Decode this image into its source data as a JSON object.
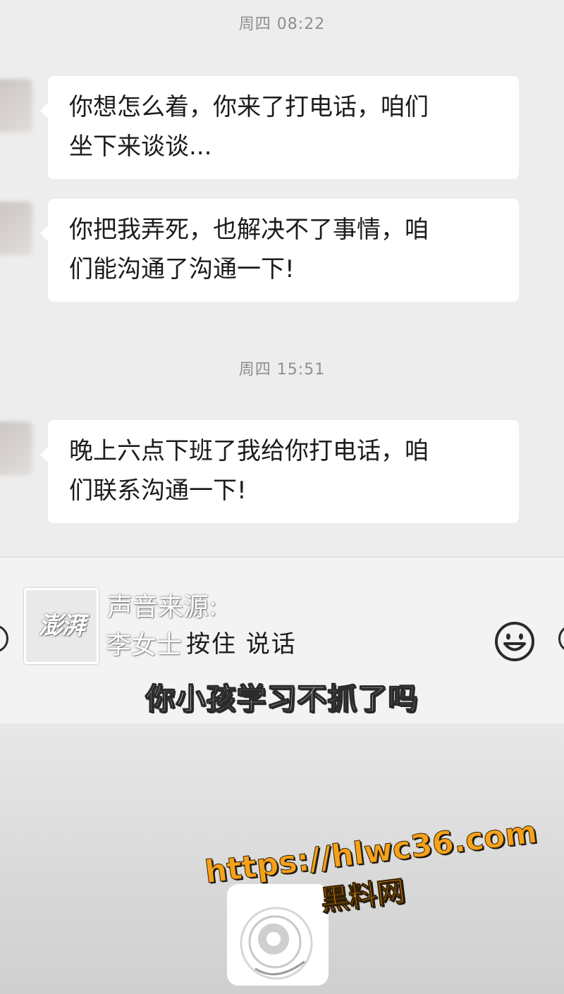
{
  "chat": {
    "messages_group_1": {
      "timestamp": "周四 08:22",
      "messages": [
        {
          "line1": "你想怎么着，你来了打电话，咱们",
          "line2": "坐下来谈谈..."
        },
        {
          "line1": "你把我弄死，也解决不了事情，咱",
          "line2": "们能沟通了沟通一下!"
        }
      ]
    },
    "messages_group_2": {
      "timestamp": "周四 15:51",
      "messages": [
        {
          "line1": "晚上六点下班了我给你打电话，咱",
          "line2": "们联系沟通一下!"
        }
      ]
    }
  },
  "input_bar": {
    "hold_to_talk": "按住 说话",
    "voice_icon": "voice-icon",
    "emoji_icon": "emoji-icon",
    "add_icon": "add-icon"
  },
  "overlay": {
    "source_logo_text": "澎湃",
    "source_label": "声音来源:",
    "source_name": "李女士",
    "subtitle": "你小孩学习不抓了吗"
  },
  "watermark": {
    "url": "https://hlwc36.com",
    "site_name": "黑料网"
  },
  "colors": {
    "chat_background": "#ededed",
    "bubble": "#ffffff",
    "timestamp_text": "#8f8f8f",
    "watermark_orange": "#f5a21b"
  }
}
